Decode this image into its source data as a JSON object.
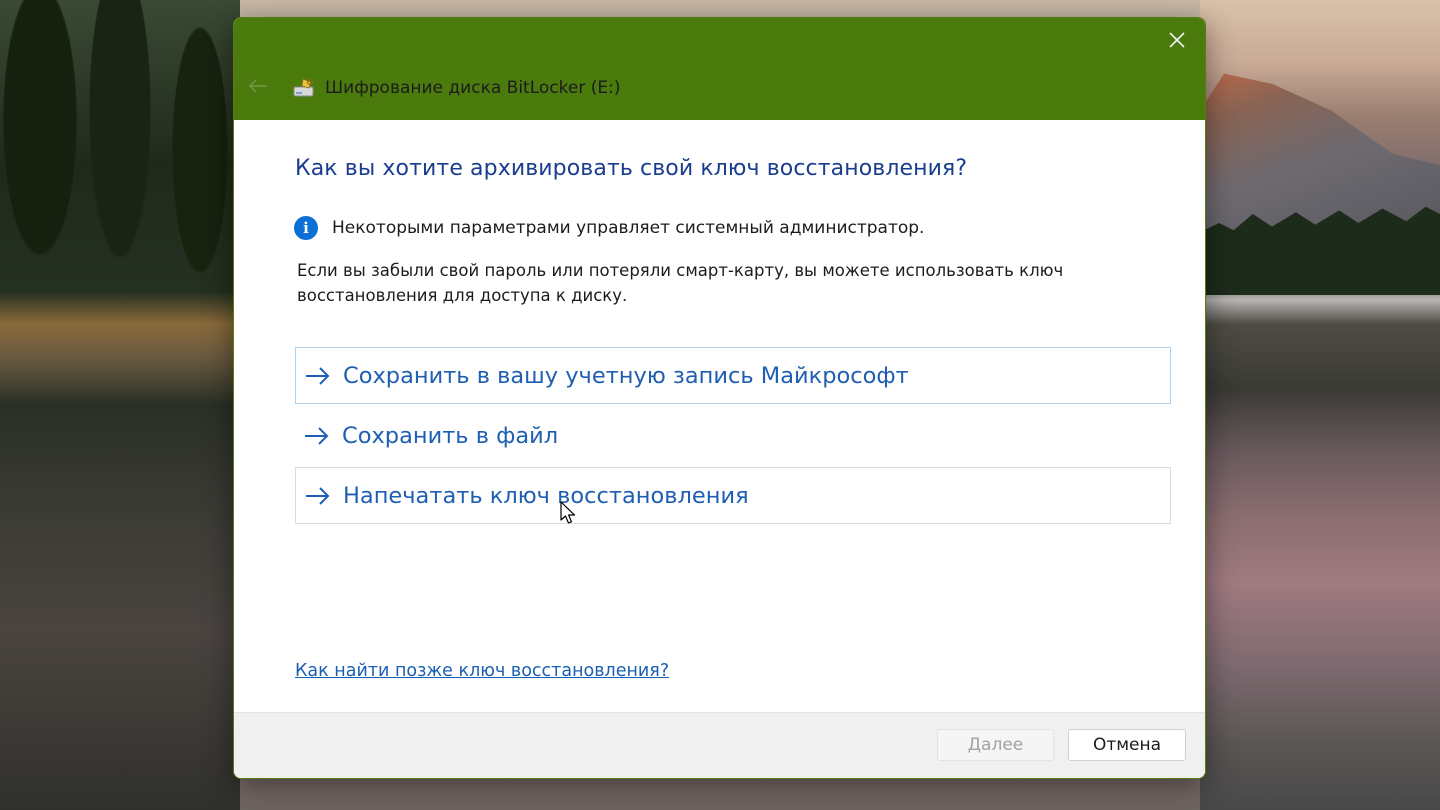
{
  "window": {
    "title": "Шифрование диска BitLocker (E:)",
    "titlebar_color": "#4b7a0d",
    "close_icon": "close-icon",
    "back_icon": "back-arrow-icon",
    "app_icon": "bitlocker-drive-icon"
  },
  "main": {
    "heading": "Как вы хотите архивировать свой ключ восстановления?",
    "info_icon": "info-icon",
    "info_text": "Некоторыми параметрами управляет системный администратор.",
    "description": "Если вы забыли свой пароль или потеряли смарт-карту, вы можете использовать ключ восстановления для доступа к диску.",
    "options": [
      {
        "label": "Сохранить в вашу учетную запись Майкрософт",
        "icon": "arrow-right-icon",
        "state": "selected"
      },
      {
        "label": "Сохранить в файл",
        "icon": "arrow-right-icon",
        "state": "normal"
      },
      {
        "label": "Напечатать ключ восстановления",
        "icon": "arrow-right-icon",
        "state": "hover"
      }
    ],
    "help_link": "Как найти позже ключ восстановления?"
  },
  "footer": {
    "next_label": "Далее",
    "next_enabled": false,
    "cancel_label": "Отмена"
  },
  "colors": {
    "accent_text": "#1f5fb3",
    "heading": "#1a3d8f",
    "info": "#0b6fd6"
  }
}
